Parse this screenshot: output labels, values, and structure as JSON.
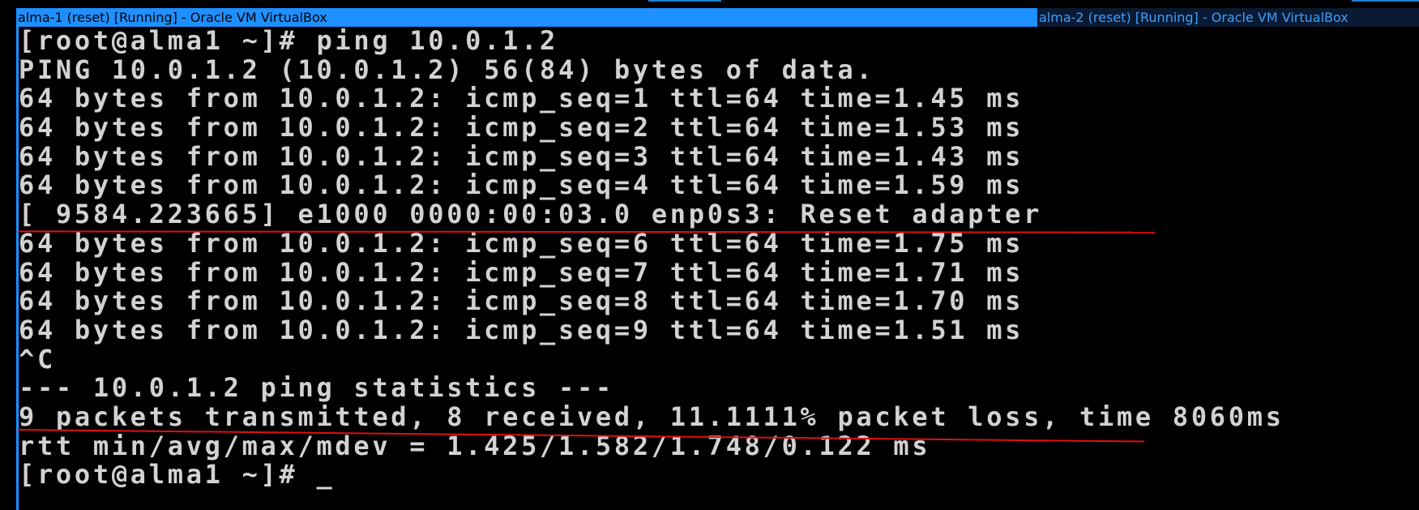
{
  "windows": {
    "left_title": "alma-1 (reset) [Running] - Oracle VM VirtualBox",
    "right_title": "alma-2 (reset) [Running] - Oracle VM VirtualBox"
  },
  "colors": {
    "titlebar_active": "#1e90ff",
    "terminal_bg": "#000000",
    "terminal_fg": "#d2d2d2",
    "annotation": "#e01010"
  },
  "terminal": {
    "lines": [
      "[root@alma1 ~]# ping 10.0.1.2",
      "PING 10.0.1.2 (10.0.1.2) 56(84) bytes of data.",
      "64 bytes from 10.0.1.2: icmp_seq=1 ttl=64 time=1.45 ms",
      "64 bytes from 10.0.1.2: icmp_seq=2 ttl=64 time=1.53 ms",
      "64 bytes from 10.0.1.2: icmp_seq=3 ttl=64 time=1.43 ms",
      "64 bytes from 10.0.1.2: icmp_seq=4 ttl=64 time=1.59 ms",
      "[ 9584.223665] e1000 0000:00:03.0 enp0s3: Reset adapter",
      "64 bytes from 10.0.1.2: icmp_seq=6 ttl=64 time=1.75 ms",
      "64 bytes from 10.0.1.2: icmp_seq=7 ttl=64 time=1.71 ms",
      "64 bytes from 10.0.1.2: icmp_seq=8 ttl=64 time=1.70 ms",
      "64 bytes from 10.0.1.2: icmp_seq=9 ttl=64 time=1.51 ms",
      "^C",
      "--- 10.0.1.2 ping statistics ---",
      "9 packets transmitted, 8 received, 11.1111% packet loss, time 8060ms",
      "rtt min/avg/max/mdev = 1.425/1.582/1.748/0.122 ms",
      "[root@alma1 ~]# _"
    ]
  }
}
